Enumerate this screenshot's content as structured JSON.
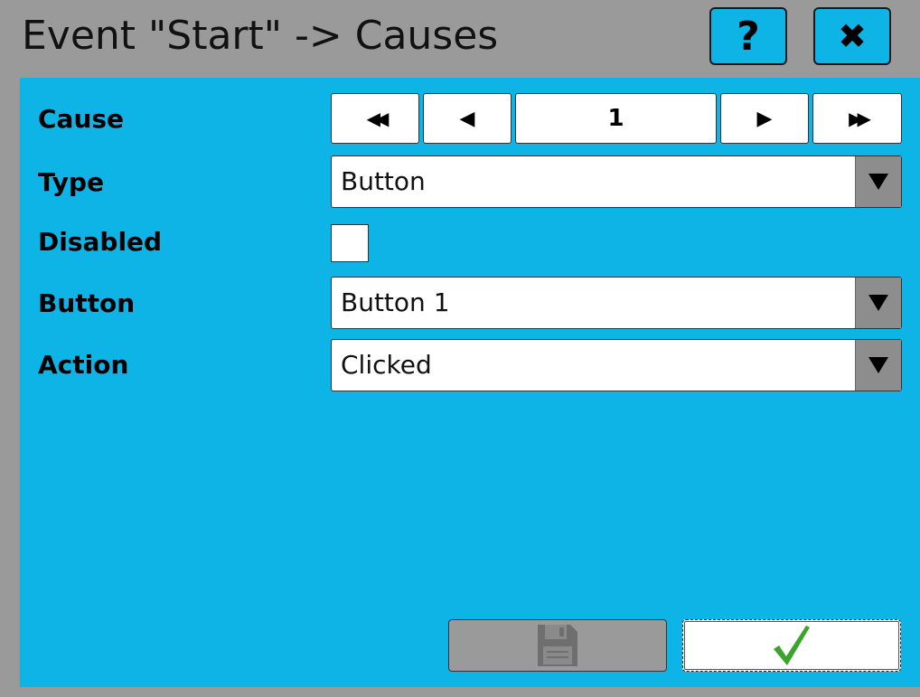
{
  "window": {
    "title": "Event \"Start\" -> Causes",
    "help_label": "?",
    "close_label": "✖"
  },
  "form": {
    "cause": {
      "label": "Cause",
      "first_label": "◀◀",
      "prev_label": "◀",
      "value": "1",
      "next_label": "▶",
      "last_label": "▶▶"
    },
    "type": {
      "label": "Type",
      "value": "Button"
    },
    "disabled": {
      "label": "Disabled",
      "checked": false
    },
    "button": {
      "label": "Button",
      "value": "Button 1"
    },
    "action": {
      "label": "Action",
      "value": "Clicked"
    }
  },
  "footer": {
    "save_icon": "save-icon",
    "ok_icon": "checkmark-icon"
  },
  "colors": {
    "panel": "#0fb4e6",
    "titlebar": "#9a9a9a",
    "check": "#3aa52a"
  }
}
